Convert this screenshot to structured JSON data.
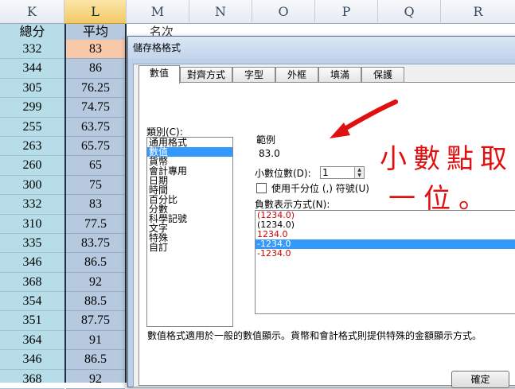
{
  "sheet": {
    "column_headers": [
      "K",
      "L",
      "M",
      "N",
      "O",
      "P",
      "Q",
      "R"
    ],
    "k_header": "總分",
    "l_header": "平均",
    "m_header": "名次",
    "k_values": [
      "332",
      "344",
      "305",
      "299",
      "255",
      "263",
      "260",
      "300",
      "332",
      "310",
      "335",
      "346",
      "368",
      "354",
      "351",
      "364",
      "346",
      "368"
    ],
    "l_values": [
      "83",
      "86",
      "76.25",
      "74.75",
      "63.75",
      "65.75",
      "65",
      "75",
      "83",
      "77.5",
      "83.75",
      "86.5",
      "92",
      "88.5",
      "87.75",
      "91",
      "86.5",
      "92"
    ]
  },
  "dialog": {
    "title": "儲存格格式",
    "tabs": [
      "數值",
      "對齊方式",
      "字型",
      "外框",
      "填滿",
      "保護"
    ],
    "active_tab": "數值",
    "category_label": "類別(C):",
    "categories": [
      "通用格式",
      "數值",
      "貨幣",
      "會計專用",
      "日期",
      "時間",
      "百分比",
      "分數",
      "科學記號",
      "文字",
      "特殊",
      "自訂"
    ],
    "selected_category": "數值",
    "sample_label": "範例",
    "sample_value": "83.0",
    "decimal_label": "小數位數(D):",
    "decimal_value": "1",
    "thousands_label": "使用千分位 (,) 符號(U)",
    "negative_label": "負數表示方式(N):",
    "negative_options": [
      "(1234.0)",
      "(1234.0)",
      "1234.0",
      "-1234.0",
      "-1234.0"
    ],
    "negative_colors": [
      "#d00000",
      "#000000",
      "#d00000",
      "#ffffff",
      "#d00000"
    ],
    "selected_negative_index": 3,
    "description": "數值格式適用於一般的數值顯示。貨幣和會計格式則提供特殊的金額顯示方式。",
    "ok_label": "確定"
  },
  "annotation": {
    "line1": "小數點取",
    "line2": "一位。",
    "color": "#e01010"
  }
}
